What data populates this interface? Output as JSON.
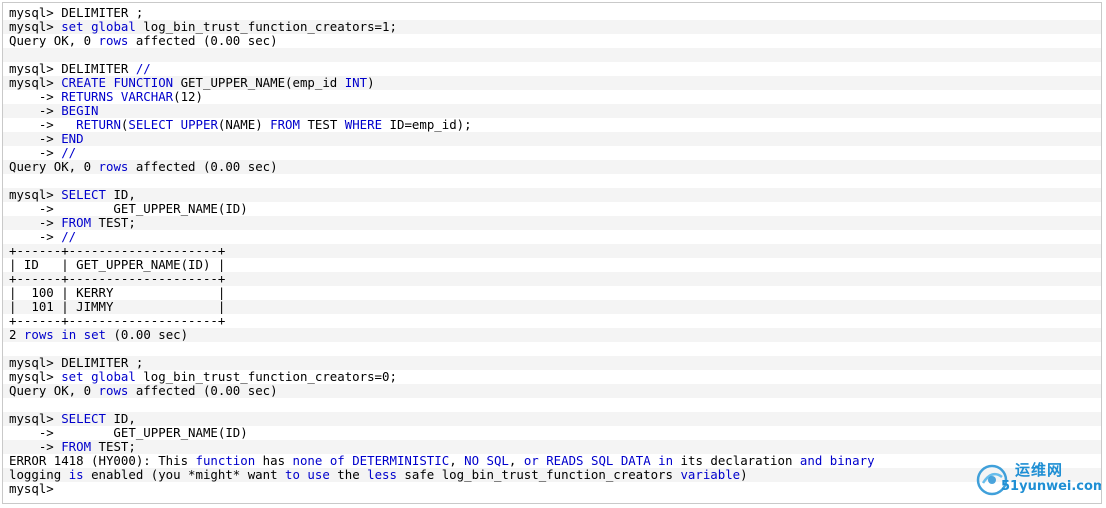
{
  "terminal": {
    "lines": [
      [
        {
          "t": "mysql> DELIMITER ;"
        }
      ],
      [
        {
          "t": "mysql> "
        },
        {
          "t": "set",
          "k": true
        },
        {
          "t": " "
        },
        {
          "t": "global",
          "k": true
        },
        {
          "t": " log_bin_trust_function_creators=1;"
        }
      ],
      [
        {
          "t": "Query OK, 0 "
        },
        {
          "t": "rows",
          "k": true
        },
        {
          "t": " affected (0.00 sec)"
        }
      ],
      [],
      [
        {
          "t": "mysql> DELIMITER "
        },
        {
          "t": "//",
          "k": true
        }
      ],
      [
        {
          "t": "mysql> "
        },
        {
          "t": "CREATE",
          "k": true
        },
        {
          "t": " "
        },
        {
          "t": "FUNCTION",
          "k": true
        },
        {
          "t": " GET_UPPER_NAME(emp_id "
        },
        {
          "t": "INT",
          "k": true
        },
        {
          "t": ")"
        }
      ],
      [
        {
          "t": "    -> "
        },
        {
          "t": "RETURNS",
          "k": true
        },
        {
          "t": " "
        },
        {
          "t": "VARCHAR",
          "k": true
        },
        {
          "t": "(12)"
        }
      ],
      [
        {
          "t": "    -> "
        },
        {
          "t": "BEGIN",
          "k": true
        }
      ],
      [
        {
          "t": "    ->   "
        },
        {
          "t": "RETURN",
          "k": true
        },
        {
          "t": "("
        },
        {
          "t": "SELECT",
          "k": true
        },
        {
          "t": " "
        },
        {
          "t": "UPPER",
          "k": true
        },
        {
          "t": "(NAME) "
        },
        {
          "t": "FROM",
          "k": true
        },
        {
          "t": " TEST "
        },
        {
          "t": "WHERE",
          "k": true
        },
        {
          "t": " ID=emp_id);"
        }
      ],
      [
        {
          "t": "    -> "
        },
        {
          "t": "END",
          "k": true
        }
      ],
      [
        {
          "t": "    -> "
        },
        {
          "t": "//",
          "k": true
        }
      ],
      [
        {
          "t": "Query OK, 0 "
        },
        {
          "t": "rows",
          "k": true
        },
        {
          "t": " affected (0.00 sec)"
        }
      ],
      [],
      [
        {
          "t": "mysql> "
        },
        {
          "t": "SELECT",
          "k": true
        },
        {
          "t": " ID,"
        }
      ],
      [
        {
          "t": "    ->        GET_UPPER_NAME(ID)"
        }
      ],
      [
        {
          "t": "    -> "
        },
        {
          "t": "FROM",
          "k": true
        },
        {
          "t": " TEST;"
        }
      ],
      [
        {
          "t": "    -> "
        },
        {
          "t": "//",
          "k": true
        }
      ],
      [
        {
          "t": "+------+--------------------+"
        }
      ],
      [
        {
          "t": "| ID   | GET_UPPER_NAME(ID) |"
        }
      ],
      [
        {
          "t": "+------+--------------------+"
        }
      ],
      [
        {
          "t": "|  100 | KERRY              |"
        }
      ],
      [
        {
          "t": "|  101 | JIMMY              |"
        }
      ],
      [
        {
          "t": "+------+--------------------+"
        }
      ],
      [
        {
          "t": "2 "
        },
        {
          "t": "rows",
          "k": true
        },
        {
          "t": " "
        },
        {
          "t": "in",
          "k": true
        },
        {
          "t": " "
        },
        {
          "t": "set",
          "k": true
        },
        {
          "t": " (0.00 sec)"
        }
      ],
      [],
      [
        {
          "t": "mysql> DELIMITER ;"
        }
      ],
      [
        {
          "t": "mysql> "
        },
        {
          "t": "set",
          "k": true
        },
        {
          "t": " "
        },
        {
          "t": "global",
          "k": true
        },
        {
          "t": " log_bin_trust_function_creators=0;"
        }
      ],
      [
        {
          "t": "Query OK, 0 "
        },
        {
          "t": "rows",
          "k": true
        },
        {
          "t": " affected (0.00 sec)"
        }
      ],
      [],
      [
        {
          "t": "mysql> "
        },
        {
          "t": "SELECT",
          "k": true
        },
        {
          "t": " ID,"
        }
      ],
      [
        {
          "t": "    ->        GET_UPPER_NAME(ID)"
        }
      ],
      [
        {
          "t": "    -> "
        },
        {
          "t": "FROM",
          "k": true
        },
        {
          "t": " TEST;"
        }
      ],
      [
        {
          "t": "ERROR 1418 (HY000): This "
        },
        {
          "t": "function",
          "k": true
        },
        {
          "t": " has "
        },
        {
          "t": "none",
          "k": true
        },
        {
          "t": " "
        },
        {
          "t": "of",
          "k": true
        },
        {
          "t": " "
        },
        {
          "t": "DETERMINISTIC",
          "k": true
        },
        {
          "t": ", "
        },
        {
          "t": "NO",
          "k": true
        },
        {
          "t": " "
        },
        {
          "t": "SQL",
          "k": true
        },
        {
          "t": ", "
        },
        {
          "t": "or",
          "k": true
        },
        {
          "t": " "
        },
        {
          "t": "READS",
          "k": true
        },
        {
          "t": " "
        },
        {
          "t": "SQL",
          "k": true
        },
        {
          "t": " "
        },
        {
          "t": "DATA",
          "k": true
        },
        {
          "t": " "
        },
        {
          "t": "in",
          "k": true
        },
        {
          "t": " its declaration "
        },
        {
          "t": "and",
          "k": true
        },
        {
          "t": " "
        },
        {
          "t": "binary",
          "k": true
        }
      ],
      [
        {
          "t": "logging "
        },
        {
          "t": "is",
          "k": true
        },
        {
          "t": " enabled (you *might* want "
        },
        {
          "t": "to",
          "k": true
        },
        {
          "t": " "
        },
        {
          "t": "use",
          "k": true
        },
        {
          "t": " the "
        },
        {
          "t": "less",
          "k": true
        },
        {
          "t": " safe log_bin_trust_function_creators "
        },
        {
          "t": "variable",
          "k": true
        },
        {
          "t": ")"
        }
      ],
      [
        {
          "t": "mysql>"
        }
      ]
    ]
  },
  "watermark": {
    "name": "运维网",
    "sub": "51yunwei.com"
  },
  "colors": {
    "keyword": "#0000cc",
    "text": "#000000",
    "stripe": "#f4f4f4",
    "watermark": "#1f8fd4"
  },
  "icons": {
    "watermark_logo": "cloud-swirl-logo-icon"
  }
}
